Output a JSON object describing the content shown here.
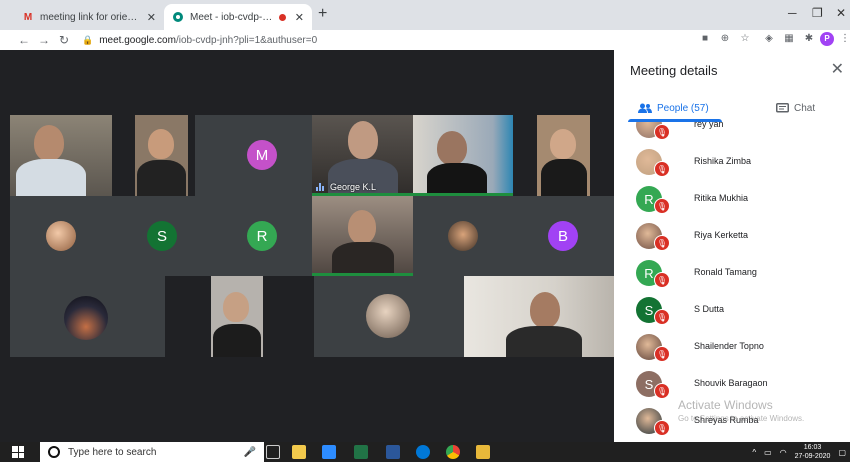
{
  "browser": {
    "tabs": [
      {
        "title": "meeting link for orientation prog",
        "icon": "gmail-icon",
        "active": false
      },
      {
        "title": "Meet - iob-cvdp-jnh",
        "icon": "meet-icon",
        "active": true
      }
    ],
    "new_tab": "+",
    "url_host": "meet.google.com",
    "url_path": "/iob-cvdp-jnh?pli=1&authuser=0",
    "profile_initial": "P"
  },
  "grid": {
    "tiles": [
      {
        "type": "video"
      },
      {
        "type": "video"
      },
      {
        "type": "avatar",
        "letter": "M",
        "color": "#c451c9"
      },
      {
        "type": "video",
        "name": "George K.L",
        "speaking": true
      },
      {
        "type": "video"
      },
      {
        "type": "video"
      },
      {
        "type": "avatar-image"
      },
      {
        "type": "avatar",
        "letter": "S",
        "color": "#137333"
      },
      {
        "type": "avatar",
        "letter": "R",
        "color": "#34a853"
      },
      {
        "type": "video",
        "speaking": true
      },
      {
        "type": "avatar-image"
      },
      {
        "type": "avatar",
        "letter": "B",
        "color": "#a142f4"
      },
      {
        "type": "avatar-image"
      },
      {
        "type": "video"
      },
      {
        "type": "avatar-image"
      },
      {
        "type": "video"
      }
    ]
  },
  "panel": {
    "title": "Meeting details",
    "people_tab": "People (57)",
    "chat_tab": "Chat",
    "participants": [
      {
        "name": "rey yah",
        "avatar": "image",
        "color": "#8d6e63"
      },
      {
        "name": "Rishika Zimba",
        "avatar": "image",
        "color": "#c0a080"
      },
      {
        "name": "Ritika Mukhia",
        "avatar": "letter",
        "letter": "R",
        "color": "#34a853"
      },
      {
        "name": "Riya Kerketta",
        "avatar": "image",
        "color": "#6d4c41"
      },
      {
        "name": "Ronald Tamang",
        "avatar": "letter",
        "letter": "R",
        "color": "#34a853"
      },
      {
        "name": "S Dutta",
        "avatar": "letter",
        "letter": "S",
        "color": "#137333"
      },
      {
        "name": "Shailender Topno",
        "avatar": "image",
        "color": "#5d4037"
      },
      {
        "name": "Shouvik Baragaon",
        "avatar": "letter",
        "letter": "S",
        "color": "#8d6e63"
      },
      {
        "name": "Shreyas Rumba",
        "avatar": "image",
        "color": "#263238"
      }
    ]
  },
  "watermark": {
    "line1": "Activate Windows",
    "line2": "Go to Settings to activate Windows."
  },
  "taskbar": {
    "search_placeholder": "Type here to search",
    "time": "16:03",
    "date": "27-09-2020"
  }
}
